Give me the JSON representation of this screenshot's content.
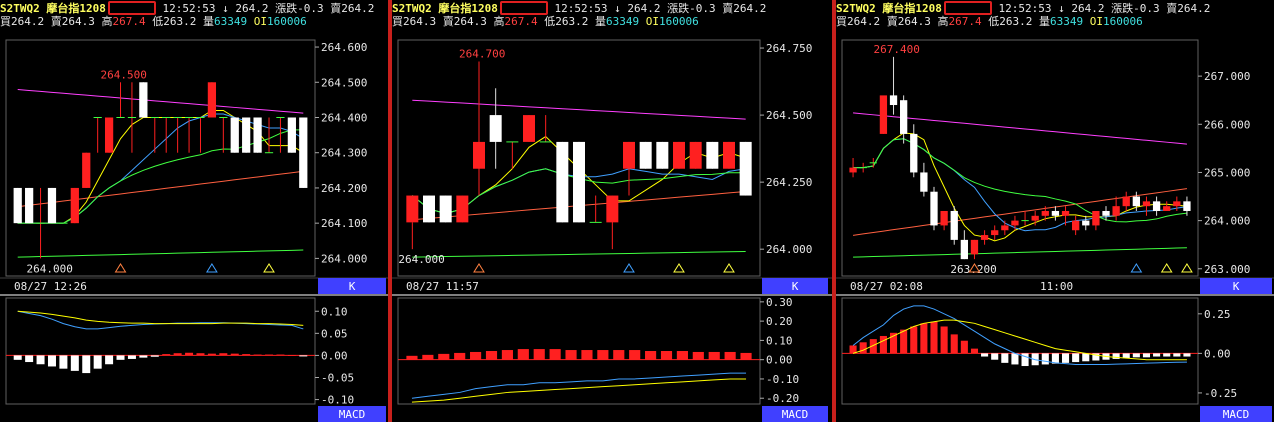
{
  "panels": [
    {
      "symbol": "S2TWQ2",
      "name": "摩台指1208",
      "time": "12:52:53",
      "arrow": "↓",
      "last": "264.2",
      "change_label": "漲跌",
      "change": "-0.3",
      "sell_label": "賣",
      "sell": "264.2",
      "buy_label": "買",
      "buy": "264.2",
      "ask_label": "賣",
      "ask": "264.3",
      "high_label": "高",
      "high": "267.4",
      "low_label": "低",
      "low": "263.2",
      "vol_label": "量",
      "vol": "63349",
      "oi_label": "OI",
      "oi": "160006",
      "time_label": "08/27 12:26",
      "time_label_mid": "",
      "k_tab": "K",
      "macd_tab": "MACD",
      "price_axis": [
        "264.600",
        "264.500",
        "264.400",
        "264.300",
        "264.200",
        "264.100",
        "264.000"
      ],
      "macd_axis": [
        "0.10",
        "0.05",
        "0.00",
        "-0.05",
        "-0.10"
      ],
      "hi_annot": "264.500",
      "lo_annot": "264.000"
    },
    {
      "symbol": "S2TWQ2",
      "name": "摩台指1208",
      "time": "12:52:53",
      "arrow": "↓",
      "last": "264.2",
      "change_label": "漲跌",
      "change": "-0.3",
      "sell_label": "賣",
      "sell": "264.2",
      "buy_label": "買",
      "buy": "264.3",
      "ask_label": "賣",
      "ask": "264.3",
      "high_label": "高",
      "high": "267.4",
      "low_label": "低",
      "low": "263.2",
      "vol_label": "量",
      "vol": "63349",
      "oi_label": "OI",
      "oi": "160006",
      "time_label": "08/27 11:57",
      "time_label_mid": "",
      "k_tab": "K",
      "macd_tab": "MACD",
      "price_axis": [
        "264.750",
        "264.500",
        "264.250",
        "264.000"
      ],
      "macd_axis": [
        "0.30",
        "0.20",
        "0.10",
        "0.00",
        "-0.10",
        "-0.20"
      ],
      "hi_annot": "264.700",
      "lo_annot": "264.000"
    },
    {
      "symbol": "S2TWQ2",
      "name": "摩台指1208",
      "time": "12:52:53",
      "arrow": "↓",
      "last": "264.2",
      "change_label": "漲跌",
      "change": "-0.3",
      "sell_label": "賣",
      "sell": "264.2",
      "buy_label": "買",
      "buy": "264.2",
      "ask_label": "賣",
      "ask": "264.3",
      "high_label": "高",
      "high": "267.4",
      "low_label": "低",
      "low": "263.2",
      "vol_label": "量",
      "vol": "63349",
      "oi_label": "OI",
      "oi": "160006",
      "time_label": "08/27 02:08",
      "time_label_mid": "11:00",
      "k_tab": "K",
      "macd_tab": "MACD",
      "price_axis": [
        "267.000",
        "266.000",
        "265.000",
        "264.000",
        "263.000"
      ],
      "macd_axis": [
        "0.25",
        "0.00",
        "-0.25"
      ],
      "hi_annot": "267.400",
      "lo_annot": "263.200"
    }
  ],
  "colors": {
    "up": "#ff2020",
    "down": "#ffffff",
    "ma5": "#ffff00",
    "ma10": "#40a0ff",
    "ma20": "#40ff40",
    "ma60": "#ff40ff",
    "ma120": "#ff6040",
    "accent": "#4040ff"
  },
  "chart_data": [
    {
      "type": "candlestick",
      "ylim": [
        263.95,
        264.62
      ],
      "candles": [
        {
          "o": 264.2,
          "h": 264.2,
          "c": 264.1,
          "l": 264.1
        },
        {
          "o": 264.2,
          "h": 264.2,
          "c": 264.1,
          "l": 264.1
        },
        {
          "o": 264.1,
          "h": 264.2,
          "c": 264.1,
          "l": 264.0
        },
        {
          "o": 264.2,
          "h": 264.2,
          "c": 264.1,
          "l": 264.1
        },
        {
          "o": 264.1,
          "h": 264.1,
          "c": 264.1,
          "l": 264.1
        },
        {
          "o": 264.1,
          "h": 264.2,
          "c": 264.2,
          "l": 264.1
        },
        {
          "o": 264.2,
          "h": 264.3,
          "c": 264.3,
          "l": 264.2
        },
        {
          "o": 264.4,
          "h": 264.4,
          "c": 264.4,
          "l": 264.3
        },
        {
          "o": 264.3,
          "h": 264.4,
          "c": 264.4,
          "l": 264.3
        },
        {
          "o": 264.4,
          "h": 264.5,
          "c": 264.4,
          "l": 264.4
        },
        {
          "o": 264.4,
          "h": 264.5,
          "c": 264.4,
          "l": 264.3
        },
        {
          "o": 264.5,
          "h": 264.5,
          "c": 264.4,
          "l": 264.4
        },
        {
          "o": 264.4,
          "h": 264.4,
          "c": 264.4,
          "l": 264.3
        },
        {
          "o": 264.4,
          "h": 264.4,
          "c": 264.4,
          "l": 264.3
        },
        {
          "o": 264.4,
          "h": 264.4,
          "c": 264.4,
          "l": 264.3
        },
        {
          "o": 264.4,
          "h": 264.4,
          "c": 264.4,
          "l": 264.3
        },
        {
          "o": 264.4,
          "h": 264.4,
          "c": 264.4,
          "l": 264.3
        },
        {
          "o": 264.4,
          "h": 264.5,
          "c": 264.5,
          "l": 264.4
        },
        {
          "o": 264.4,
          "h": 264.4,
          "c": 264.4,
          "l": 264.3
        },
        {
          "o": 264.4,
          "h": 264.4,
          "c": 264.3,
          "l": 264.3
        },
        {
          "o": 264.4,
          "h": 264.4,
          "c": 264.3,
          "l": 264.3
        },
        {
          "o": 264.4,
          "h": 264.4,
          "c": 264.3,
          "l": 264.3
        },
        {
          "o": 264.3,
          "h": 264.4,
          "c": 264.3,
          "l": 264.3
        },
        {
          "o": 264.4,
          "h": 264.4,
          "c": 264.4,
          "l": 264.3
        },
        {
          "o": 264.4,
          "h": 264.4,
          "c": 264.3,
          "l": 264.3
        },
        {
          "o": 264.4,
          "h": 264.4,
          "c": 264.2,
          "l": 264.2
        }
      ],
      "macd_ylim": [
        -0.11,
        0.13
      ],
      "macd_hist": [
        -0.01,
        -0.015,
        -0.02,
        -0.025,
        -0.03,
        -0.035,
        -0.04,
        -0.03,
        -0.02,
        -0.01,
        -0.008,
        -0.005,
        -0.003,
        0.003,
        0.005,
        0.006,
        0.005,
        0.004,
        0.005,
        0.004,
        0.003,
        0.002,
        0.002,
        0.002,
        0.001,
        -0.002
      ],
      "macd_line": [
        0.1,
        0.095,
        0.09,
        0.082,
        0.072,
        0.065,
        0.06,
        0.06,
        0.063,
        0.066,
        0.068,
        0.07,
        0.071,
        0.072,
        0.073,
        0.073,
        0.074,
        0.074,
        0.074,
        0.073,
        0.072,
        0.071,
        0.07,
        0.069,
        0.068,
        0.06
      ],
      "signal_line": [
        0.1,
        0.098,
        0.096,
        0.093,
        0.089,
        0.085,
        0.08,
        0.077,
        0.075,
        0.074,
        0.073,
        0.073,
        0.072,
        0.072,
        0.072,
        0.072,
        0.072,
        0.072,
        0.073,
        0.073,
        0.073,
        0.072,
        0.072,
        0.071,
        0.07,
        0.068
      ],
      "markers": [
        9,
        17,
        22
      ]
    },
    {
      "type": "candlestick",
      "ylim": [
        263.9,
        264.78
      ],
      "candles": [
        {
          "o": 264.1,
          "h": 264.1,
          "c": 264.2,
          "l": 264.0
        },
        {
          "o": 264.2,
          "h": 264.2,
          "c": 264.1,
          "l": 264.1
        },
        {
          "o": 264.2,
          "h": 264.2,
          "c": 264.1,
          "l": 264.1
        },
        {
          "o": 264.1,
          "h": 264.2,
          "c": 264.2,
          "l": 264.1
        },
        {
          "o": 264.3,
          "h": 264.7,
          "c": 264.4,
          "l": 264.2
        },
        {
          "o": 264.5,
          "h": 264.6,
          "c": 264.4,
          "l": 264.3
        },
        {
          "o": 264.4,
          "h": 264.4,
          "c": 264.4,
          "l": 264.3
        },
        {
          "o": 264.4,
          "h": 264.5,
          "c": 264.5,
          "l": 264.4
        },
        {
          "o": 264.4,
          "h": 264.5,
          "c": 264.4,
          "l": 264.4
        },
        {
          "o": 264.4,
          "h": 264.4,
          "c": 264.1,
          "l": 264.1
        },
        {
          "o": 264.4,
          "h": 264.4,
          "c": 264.1,
          "l": 264.1
        },
        {
          "o": 264.1,
          "h": 264.2,
          "c": 264.1,
          "l": 264.1
        },
        {
          "o": 264.1,
          "h": 264.2,
          "c": 264.2,
          "l": 264.0
        },
        {
          "o": 264.3,
          "h": 264.4,
          "c": 264.4,
          "l": 264.2
        },
        {
          "o": 264.4,
          "h": 264.4,
          "c": 264.3,
          "l": 264.3
        },
        {
          "o": 264.4,
          "h": 264.4,
          "c": 264.3,
          "l": 264.3
        },
        {
          "o": 264.3,
          "h": 264.4,
          "c": 264.4,
          "l": 264.3
        },
        {
          "o": 264.3,
          "h": 264.4,
          "c": 264.4,
          "l": 264.3
        },
        {
          "o": 264.4,
          "h": 264.4,
          "c": 264.3,
          "l": 264.3
        },
        {
          "o": 264.3,
          "h": 264.4,
          "c": 264.4,
          "l": 264.3
        },
        {
          "o": 264.4,
          "h": 264.4,
          "c": 264.2,
          "l": 264.2
        }
      ],
      "macd_ylim": [
        -0.23,
        0.32
      ],
      "macd_hist": [
        0.02,
        0.025,
        0.03,
        0.035,
        0.04,
        0.045,
        0.05,
        0.055,
        0.055,
        0.055,
        0.05,
        0.05,
        0.05,
        0.05,
        0.05,
        0.045,
        0.045,
        0.045,
        0.04,
        0.04,
        0.04,
        0.035
      ],
      "macd_line": [
        -0.2,
        -0.19,
        -0.18,
        -0.17,
        -0.15,
        -0.14,
        -0.13,
        -0.13,
        -0.12,
        -0.12,
        -0.115,
        -0.11,
        -0.11,
        -0.1,
        -0.1,
        -0.095,
        -0.09,
        -0.085,
        -0.08,
        -0.075,
        -0.07,
        -0.07
      ],
      "signal_line": [
        -0.22,
        -0.215,
        -0.21,
        -0.2,
        -0.19,
        -0.18,
        -0.17,
        -0.165,
        -0.16,
        -0.155,
        -0.15,
        -0.145,
        -0.14,
        -0.135,
        -0.13,
        -0.125,
        -0.12,
        -0.115,
        -0.11,
        -0.105,
        -0.1,
        -0.1
      ],
      "markers": [
        4,
        13,
        16,
        19
      ]
    },
    {
      "type": "candlestick",
      "ylim": [
        262.85,
        267.75
      ],
      "candles": [
        {
          "o": 265.0,
          "h": 265.3,
          "c": 265.1,
          "l": 264.9
        },
        {
          "o": 265.1,
          "h": 265.2,
          "c": 265.1,
          "l": 265.0
        },
        {
          "o": 265.2,
          "h": 265.3,
          "c": 265.2,
          "l": 265.1
        },
        {
          "o": 265.8,
          "h": 266.5,
          "c": 266.6,
          "l": 265.8
        },
        {
          "o": 266.6,
          "h": 267.4,
          "c": 266.4,
          "l": 266.2
        },
        {
          "o": 266.5,
          "h": 266.6,
          "c": 265.8,
          "l": 265.6
        },
        {
          "o": 265.8,
          "h": 266.0,
          "c": 265.0,
          "l": 264.9
        },
        {
          "o": 265.0,
          "h": 265.2,
          "c": 264.6,
          "l": 264.5
        },
        {
          "o": 264.6,
          "h": 264.7,
          "c": 263.9,
          "l": 263.8
        },
        {
          "o": 263.9,
          "h": 264.2,
          "c": 264.2,
          "l": 263.8
        },
        {
          "o": 264.2,
          "h": 264.3,
          "c": 263.6,
          "l": 263.5
        },
        {
          "o": 263.6,
          "h": 263.8,
          "c": 263.2,
          "l": 263.2
        },
        {
          "o": 263.3,
          "h": 263.6,
          "c": 263.6,
          "l": 263.2
        },
        {
          "o": 263.6,
          "h": 263.8,
          "c": 263.7,
          "l": 263.5
        },
        {
          "o": 263.7,
          "h": 263.9,
          "c": 263.8,
          "l": 263.6
        },
        {
          "o": 263.8,
          "h": 264.0,
          "c": 263.9,
          "l": 263.7
        },
        {
          "o": 263.9,
          "h": 264.1,
          "c": 264.0,
          "l": 263.8
        },
        {
          "o": 264.0,
          "h": 264.2,
          "c": 264.0,
          "l": 263.9
        },
        {
          "o": 264.0,
          "h": 264.2,
          "c": 264.1,
          "l": 263.9
        },
        {
          "o": 264.1,
          "h": 264.3,
          "c": 264.2,
          "l": 264.0
        },
        {
          "o": 264.2,
          "h": 264.3,
          "c": 264.1,
          "l": 264.0
        },
        {
          "o": 264.1,
          "h": 264.3,
          "c": 264.2,
          "l": 263.9
        },
        {
          "o": 263.8,
          "h": 264.1,
          "c": 264.0,
          "l": 263.7
        },
        {
          "o": 264.0,
          "h": 264.1,
          "c": 263.9,
          "l": 263.8
        },
        {
          "o": 263.9,
          "h": 264.2,
          "c": 264.2,
          "l": 263.8
        },
        {
          "o": 264.2,
          "h": 264.3,
          "c": 264.1,
          "l": 264.0
        },
        {
          "o": 264.1,
          "h": 264.5,
          "c": 264.3,
          "l": 264.0
        },
        {
          "o": 264.3,
          "h": 264.6,
          "c": 264.5,
          "l": 264.2
        },
        {
          "o": 264.5,
          "h": 264.6,
          "c": 264.3,
          "l": 264.2
        },
        {
          "o": 264.3,
          "h": 264.5,
          "c": 264.4,
          "l": 264.1
        },
        {
          "o": 264.4,
          "h": 264.5,
          "c": 264.2,
          "l": 264.1
        },
        {
          "o": 264.2,
          "h": 264.4,
          "c": 264.3,
          "l": 264.2
        },
        {
          "o": 264.3,
          "h": 264.5,
          "c": 264.4,
          "l": 264.2
        },
        {
          "o": 264.4,
          "h": 264.5,
          "c": 264.2,
          "l": 264.1
        }
      ],
      "macd_ylim": [
        -0.32,
        0.35
      ],
      "macd_hist": [
        0.05,
        0.07,
        0.09,
        0.11,
        0.13,
        0.15,
        0.17,
        0.19,
        0.2,
        0.17,
        0.12,
        0.08,
        0.03,
        -0.02,
        -0.04,
        -0.06,
        -0.07,
        -0.08,
        -0.075,
        -0.07,
        -0.065,
        -0.06,
        -0.055,
        -0.05,
        -0.045,
        -0.04,
        -0.035,
        -0.03,
        -0.025,
        -0.025,
        -0.02,
        -0.02,
        -0.02,
        -0.02
      ],
      "macd_line": [
        0.05,
        0.1,
        0.14,
        0.18,
        0.24,
        0.28,
        0.3,
        0.3,
        0.28,
        0.25,
        0.22,
        0.18,
        0.14,
        0.1,
        0.06,
        0.03,
        0.0,
        -0.02,
        -0.04,
        -0.05,
        -0.06,
        -0.065,
        -0.07,
        -0.07,
        -0.07,
        -0.07,
        -0.068,
        -0.066,
        -0.064,
        -0.062,
        -0.06,
        -0.058,
        -0.056,
        -0.055
      ],
      "signal_line": [
        0.0,
        0.02,
        0.05,
        0.08,
        0.11,
        0.14,
        0.17,
        0.19,
        0.2,
        0.21,
        0.21,
        0.2,
        0.19,
        0.17,
        0.15,
        0.13,
        0.11,
        0.09,
        0.07,
        0.05,
        0.03,
        0.02,
        0.01,
        0.0,
        -0.01,
        -0.02,
        -0.025,
        -0.03,
        -0.035,
        -0.04,
        -0.04,
        -0.04,
        -0.04,
        -0.04
      ],
      "markers": [
        12,
        28,
        31,
        33
      ]
    }
  ]
}
